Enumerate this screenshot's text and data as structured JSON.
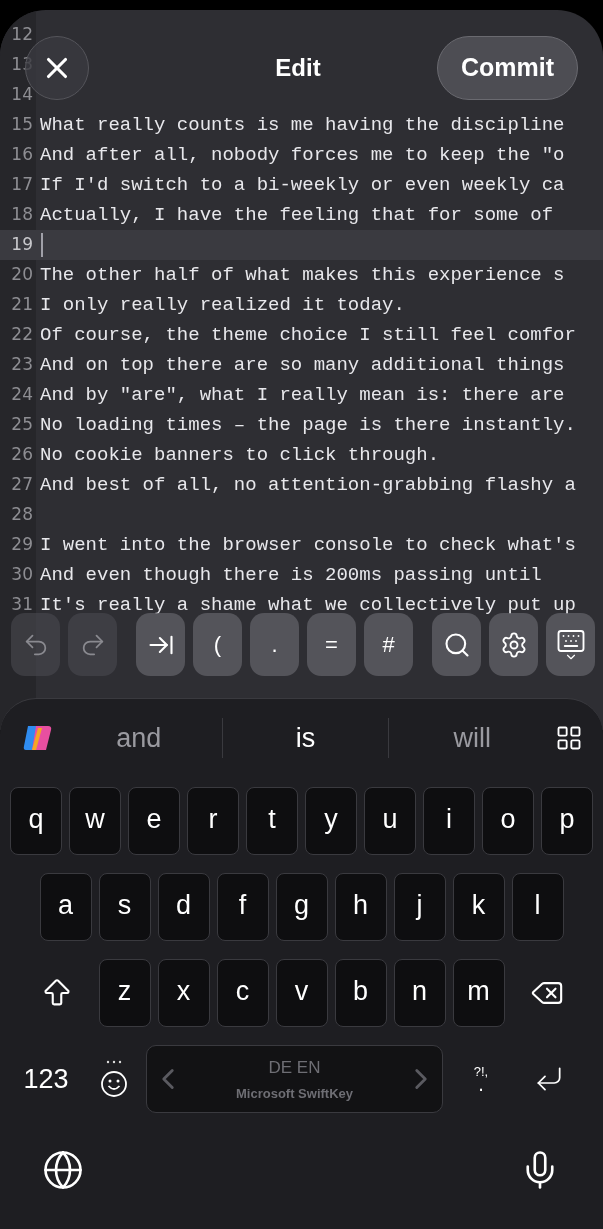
{
  "header": {
    "title": "Edit",
    "commit": "Commit"
  },
  "editor": {
    "lines": [
      {
        "number": "12",
        "current": false
      },
      {
        "number": "13",
        "current": false
      },
      {
        "number": "14",
        "current": false
      },
      {
        "number": "15",
        "text": "What really counts is me having the discipline",
        "current": false
      },
      {
        "number": "16",
        "text": "And after all, nobody forces me to keep the \"o",
        "current": false
      },
      {
        "number": "17",
        "text": "If I'd switch to a bi-weekly or even weekly ca",
        "current": false
      },
      {
        "number": "18",
        "text": "Actually, I have the feeling that for some of",
        "current": false
      },
      {
        "number": "19",
        "current": true
      },
      {
        "number": "20",
        "text": "The other half of what makes this experience s",
        "current": false
      },
      {
        "number": "21",
        "text": "I only really realized it today.",
        "current": false
      },
      {
        "number": "22",
        "text": "Of course, the theme choice I still feel comfor",
        "current": false
      },
      {
        "number": "23",
        "text": "And on top there are so many additional things",
        "current": false
      },
      {
        "number": "24",
        "text": "And by \"are\", what I really mean is: there are",
        "current": false
      },
      {
        "number": "25",
        "text": "No loading times – the page is there instantly.",
        "current": false
      },
      {
        "number": "26",
        "text": "No cookie banners to click through.",
        "current": false
      },
      {
        "number": "27",
        "text": "And best of all, no attention-grabbing flashy a",
        "current": false
      },
      {
        "number": "28",
        "current": false
      },
      {
        "number": "29",
        "text": "I went into the browser console to check what's",
        "current": false
      },
      {
        "number": "30",
        "text": "And even though there is 200ms passing until",
        "current": false
      },
      {
        "number": "31",
        "text": "It's really a shame what we collectively put up",
        "current": false
      }
    ]
  },
  "toolbar": {
    "groups": [
      [
        {
          "kind": "undo",
          "disabled": true
        },
        {
          "kind": "redo",
          "disabled": true
        }
      ],
      [
        {
          "kind": "tab",
          "disabled": false
        },
        {
          "kind": "char",
          "label": "(",
          "disabled": false
        },
        {
          "kind": "char",
          "label": ".",
          "disabled": false
        },
        {
          "kind": "char",
          "label": "=",
          "disabled": false
        },
        {
          "kind": "char",
          "label": "#",
          "disabled": false
        }
      ],
      [
        {
          "kind": "search",
          "disabled": false
        },
        {
          "kind": "settings",
          "disabled": false
        },
        {
          "kind": "hide-keyboard",
          "disabled": false
        }
      ]
    ]
  },
  "suggestions": [
    {
      "text": "and",
      "selected": false
    },
    {
      "text": "is",
      "selected": true
    },
    {
      "text": "will",
      "selected": false
    }
  ],
  "keyboard": {
    "rows": [
      [
        "q",
        "w",
        "e",
        "r",
        "t",
        "y",
        "u",
        "i",
        "o",
        "p"
      ],
      [
        "a",
        "s",
        "d",
        "f",
        "g",
        "h",
        "j",
        "k",
        "l"
      ],
      [
        "z",
        "x",
        "c",
        "v",
        "b",
        "n",
        "m"
      ]
    ],
    "numbers_key": "123",
    "space": {
      "languages": "DE EN",
      "brand": "Microsoft SwiftKey"
    },
    "punctuation": {
      "top": "?!,",
      "bottom": "."
    }
  }
}
